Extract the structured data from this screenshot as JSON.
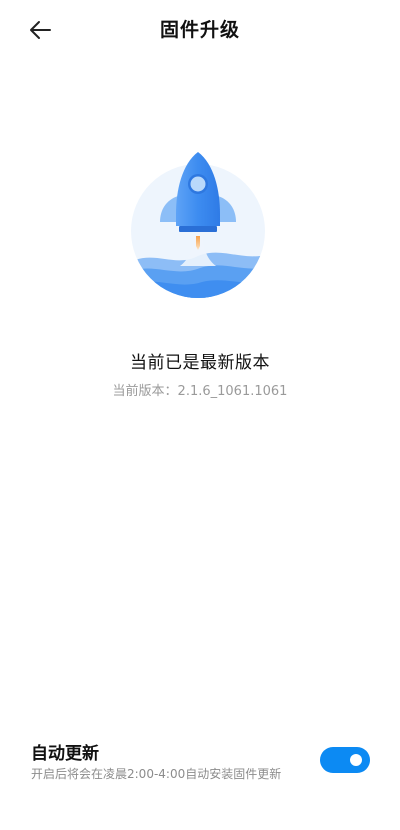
{
  "header": {
    "back_icon": "arrow-left-icon",
    "title": "固件升级"
  },
  "hero": {
    "icon": "rocket-launch-illustration",
    "colors": {
      "circle_bg": "#eef5fd",
      "rocket": "#3f8ef0",
      "waves": "#5aa0f2"
    }
  },
  "status": {
    "title": "当前已是最新版本",
    "version_label": "当前版本：2.1.6_1061.1061"
  },
  "auto_update": {
    "title": "自动更新",
    "description": "开启后将会在凌晨2:00-4:00自动安装固件更新",
    "enabled": true,
    "accent_color": "#0c8af3"
  }
}
